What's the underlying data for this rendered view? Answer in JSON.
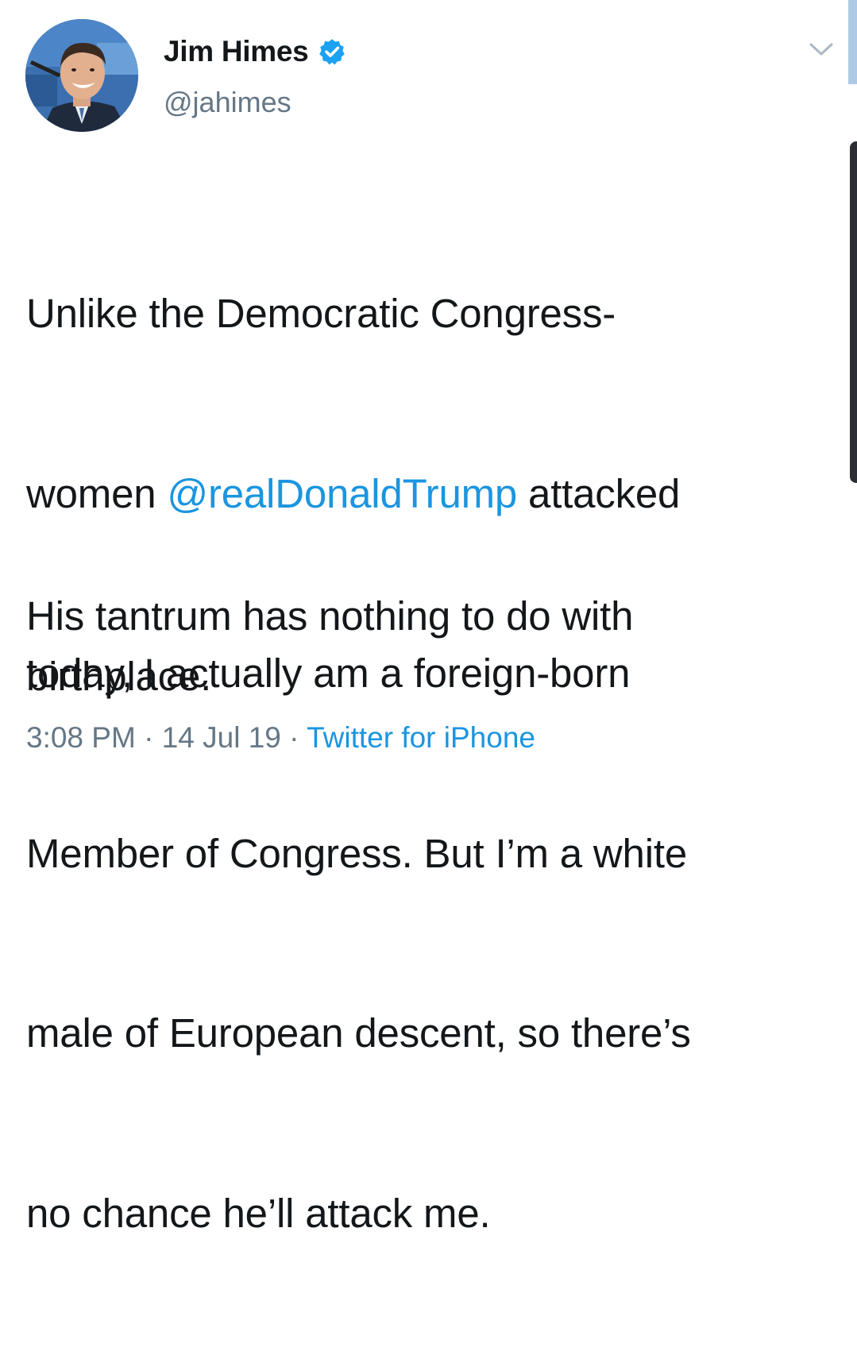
{
  "tweet": {
    "author": {
      "display_name": "Jim Himes",
      "handle": "@jahimes",
      "verified": true,
      "avatar_icon": "profile-photo"
    },
    "menu_icon": "chevron-down-icon",
    "text_lines": {
      "l1_part": "Unlike the Democratic Congress-",
      "l2_pre": "women ",
      "l2_mention": "@realDonaldTrump",
      "l2_post": " attacked",
      "l3": "today, I actually am a foreign-born",
      "l4": "Member of Congress. But I’m a white",
      "l5": "male of European descent, so there’s",
      "l6": "no chance he’ll attack me."
    },
    "text_lines2": {
      "l1": "His tantrum has nothing to do with",
      "l2": "birthplace."
    },
    "meta": {
      "time": "3:08 PM",
      "sep1": " · ",
      "date": "14 Jul 19",
      "sep2": " · ",
      "source": "Twitter for iPhone"
    }
  },
  "colors": {
    "link": "#1b95e0",
    "verified": "#1da1f2",
    "secondary_text": "#657786",
    "primary_text": "#14171a"
  }
}
